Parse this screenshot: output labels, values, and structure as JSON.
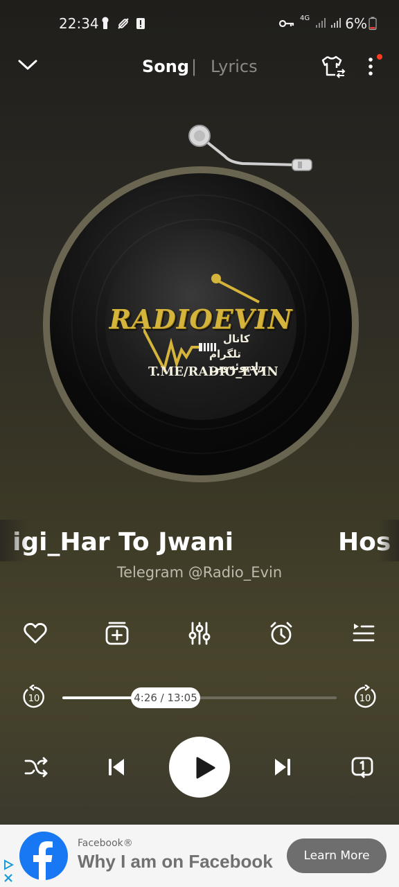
{
  "status_bar": {
    "time": "22:34",
    "network": "4G",
    "battery": "6%"
  },
  "header": {
    "tab_song": "Song",
    "tab_separator": "|",
    "tab_lyrics": "Lyrics",
    "notification_dot_color": "#ff3b1f"
  },
  "album_art": {
    "logo_text": "RADIOEVIN",
    "fa_line1": "کانال",
    "fa_line2": "تلگرام رادیوئه‌وین",
    "url_text": "T.ME/RADIO_EVIN"
  },
  "track": {
    "title_visible": "igi_Har To Jwani",
    "title_next_fragment": "Hos",
    "artist": "Telegram @Radio_Evin"
  },
  "actions": [
    "heart-icon",
    "add-to-playlist-icon",
    "equalizer-icon",
    "sleep-timer-icon",
    "queue-icon"
  ],
  "progress": {
    "current_time": "4:26",
    "total_time": "13:05",
    "label": "4:26 / 13:05",
    "fraction": 0.34,
    "rewind_seconds": "10",
    "forward_seconds": "10"
  },
  "ad": {
    "sponsor": "Facebook®",
    "headline": "Why I am on Facebook",
    "cta": "Learn More"
  },
  "colors": {
    "accent_white": "#ffffff",
    "ad_brand": "#1877f2",
    "logo_gold": "#d4b43a"
  }
}
